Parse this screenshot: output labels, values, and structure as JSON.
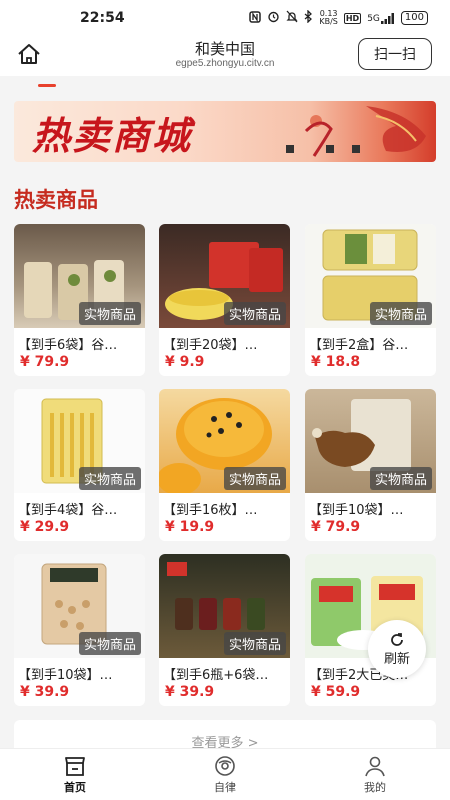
{
  "status_bar": {
    "time": "22:54",
    "net_speed_value": "0.13",
    "net_speed_unit": "KB/S",
    "hd": "HD",
    "signal": "5G",
    "battery": "100"
  },
  "header": {
    "title": "和美中国",
    "subtitle": "egpe5.zhongyu.citv.cn",
    "scan_label": "扫一扫"
  },
  "banner": {
    "title": "热卖商城"
  },
  "section": {
    "title": "热卖商品"
  },
  "products": [
    {
      "name": "【到手6袋】谷…",
      "price": "¥ 79.9",
      "tag": "实物商品"
    },
    {
      "name": "【到手20袋】…",
      "price": "¥ 9.9",
      "tag": "实物商品"
    },
    {
      "name": "【到手2盒】谷…",
      "price": "¥ 18.8",
      "tag": "实物商品"
    },
    {
      "name": "【到手4袋】谷…",
      "price": "¥ 29.9",
      "tag": "实物商品"
    },
    {
      "name": "【到手16枚】…",
      "price": "¥ 19.9",
      "tag": "实物商品"
    },
    {
      "name": "【到手10袋】…",
      "price": "¥ 79.9",
      "tag": "实物商品"
    },
    {
      "name": "【到手10袋】…",
      "price": "¥ 39.9",
      "tag": "实物商品"
    },
    {
      "name": "【到手6瓶+6袋…",
      "price": "¥ 39.9",
      "tag": "实物商品"
    },
    {
      "name": "【到手2大已美…",
      "price": "¥ 59.9",
      "tag": ""
    }
  ],
  "refresh_label": "刷新",
  "more_label": "查看更多 >",
  "nav": [
    {
      "label": "首页"
    },
    {
      "label": "自律"
    },
    {
      "label": "我的"
    }
  ],
  "colors": {
    "accent": "#e02c2c",
    "section_title": "#c62b1f"
  }
}
